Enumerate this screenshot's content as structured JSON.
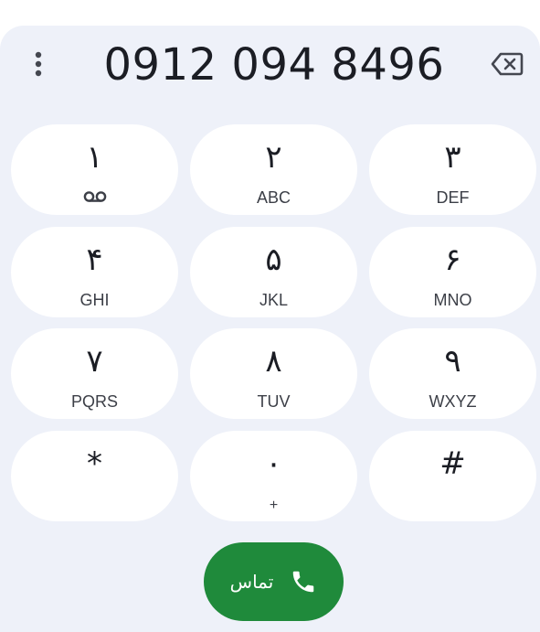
{
  "header": {
    "menu_icon": "more-vert-icon",
    "number": "0912 094 8496",
    "backspace_icon": "backspace-icon"
  },
  "keys": [
    {
      "digit": "۱",
      "letters": "",
      "sub_icon": "voicemail-icon"
    },
    {
      "digit": "۲",
      "letters": "ABC"
    },
    {
      "digit": "۳",
      "letters": "DEF"
    },
    {
      "digit": "۴",
      "letters": "GHI"
    },
    {
      "digit": "۵",
      "letters": "JKL"
    },
    {
      "digit": "۶",
      "letters": "MNO"
    },
    {
      "digit": "۷",
      "letters": "PQRS"
    },
    {
      "digit": "۸",
      "letters": "TUV"
    },
    {
      "digit": "۹",
      "letters": "WXYZ"
    },
    {
      "digit": "*",
      "letters": ""
    },
    {
      "digit": "۰",
      "letters": "+"
    },
    {
      "digit": "#",
      "letters": ""
    }
  ],
  "call": {
    "label": "تماس",
    "icon": "phone-icon",
    "color": "#1f8a3b"
  },
  "colors": {
    "background": "#eef1f9",
    "key_background": "#ffffff",
    "text": "#1b1d24"
  }
}
